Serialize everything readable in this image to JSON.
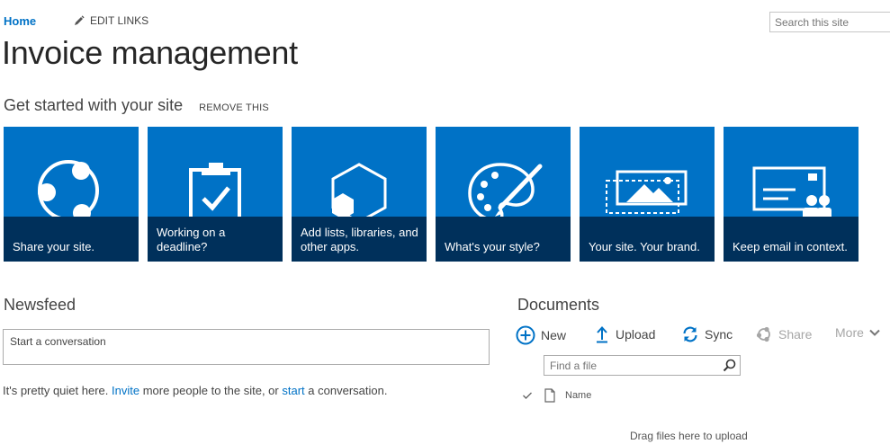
{
  "nav": {
    "home_label": "Home",
    "edit_links_label": "EDIT LINKS"
  },
  "search": {
    "placeholder": "Search this site"
  },
  "page": {
    "title": "Invoice management"
  },
  "get_started": {
    "title": "Get started with your site",
    "remove_label": "REMOVE THIS",
    "tiles": [
      {
        "label": "Share your site.",
        "icon": "share-icon"
      },
      {
        "label": "Working on a deadline?",
        "icon": "clipboard-check-icon"
      },
      {
        "label": "Add lists, libraries, and other apps.",
        "icon": "apps-hexagon-icon"
      },
      {
        "label": "What's your style?",
        "icon": "palette-icon"
      },
      {
        "label": "Your site. Your brand.",
        "icon": "brand-image-icon"
      },
      {
        "label": "Keep email in context.",
        "icon": "email-people-icon"
      }
    ]
  },
  "newsfeed": {
    "title": "Newsfeed",
    "conversation_placeholder": "Start a conversation",
    "quiet_pre": "It's pretty quiet here.",
    "invite_link": "Invite",
    "quiet_mid": "more people to the site, or",
    "start_link": "start",
    "quiet_post": "a conversation."
  },
  "documents": {
    "title": "Documents",
    "toolbar": {
      "new": "New",
      "upload": "Upload",
      "sync": "Sync",
      "share": "Share",
      "more": "More"
    },
    "find_placeholder": "Find a file",
    "column_name": "Name",
    "drag_hint": "Drag files here to upload"
  },
  "colors": {
    "tile_blue": "#0072c6",
    "tile_band": "#00305b",
    "link_blue": "#0072c6"
  }
}
